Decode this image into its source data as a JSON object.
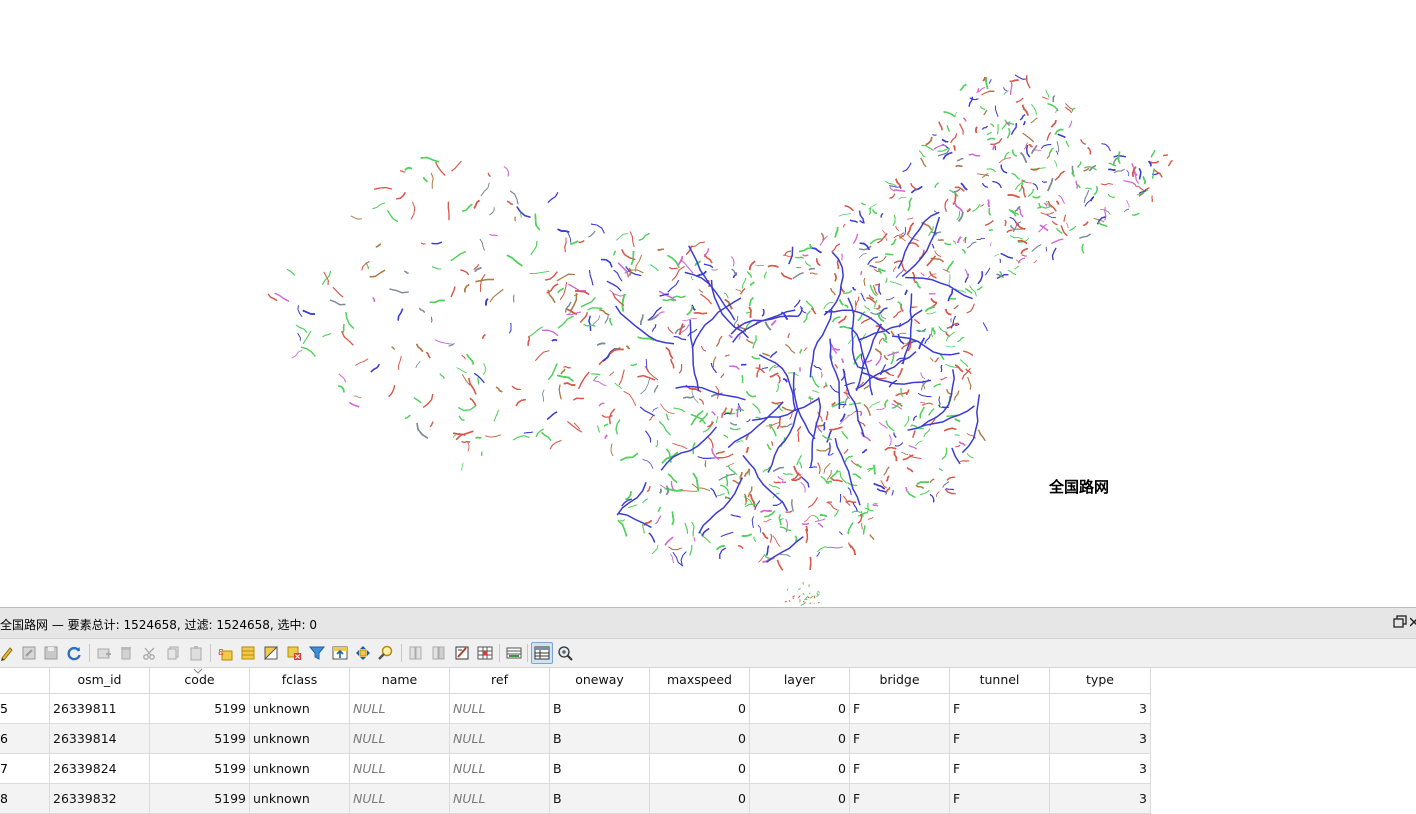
{
  "map": {
    "layer_label": "全国路网",
    "road_colors": [
      "#3b3bd6",
      "#d8584a",
      "#4fd15a",
      "#d06ad6",
      "#b07a4a",
      "#7a8a99"
    ]
  },
  "dock": {
    "title": "全国路网 — 要素总计: 1524658, 过滤: 1524658, 选中: 0",
    "float_icon": "restore-window-icon",
    "close_icon": "close-icon"
  },
  "toolbar": {
    "buttons": [
      "toggle-edit-icon",
      "multi-edit-icon",
      "save-edits-icon",
      "reload-icon",
      "add-feature-icon",
      "delete-feature-icon",
      "cut-icon",
      "copy-icon",
      "paste-icon",
      "select-by-expression-icon",
      "select-all-icon",
      "invert-selection-icon",
      "deselect-all-icon",
      "filter-icon",
      "move-selection-to-top-icon",
      "pan-to-selection-icon",
      "zoom-to-selection-icon",
      "new-field-icon",
      "delete-field-icon",
      "field-calculator-icon",
      "conditional-formatting-icon",
      "dock-table-icon",
      "form-view-icon",
      "table-view-icon"
    ]
  },
  "table": {
    "columns": [
      "osm_id",
      "code",
      "fclass",
      "name",
      "ref",
      "oneway",
      "maxspeed",
      "layer",
      "bridge",
      "tunnel",
      "type"
    ],
    "rows": [
      {
        "row_header": "5",
        "cells": [
          "26339811",
          "5199",
          "unknown",
          "NULL",
          "NULL",
          "B",
          "0",
          "0",
          "F",
          "F",
          "3"
        ]
      },
      {
        "row_header": "6",
        "cells": [
          "26339814",
          "5199",
          "unknown",
          "NULL",
          "NULL",
          "B",
          "0",
          "0",
          "F",
          "F",
          "3"
        ]
      },
      {
        "row_header": "7",
        "cells": [
          "26339824",
          "5199",
          "unknown",
          "NULL",
          "NULL",
          "B",
          "0",
          "0",
          "F",
          "F",
          "3"
        ]
      },
      {
        "row_header": "8",
        "cells": [
          "26339832",
          "5199",
          "unknown",
          "NULL",
          "NULL",
          "B",
          "0",
          "0",
          "F",
          "F",
          "3"
        ]
      }
    ]
  }
}
